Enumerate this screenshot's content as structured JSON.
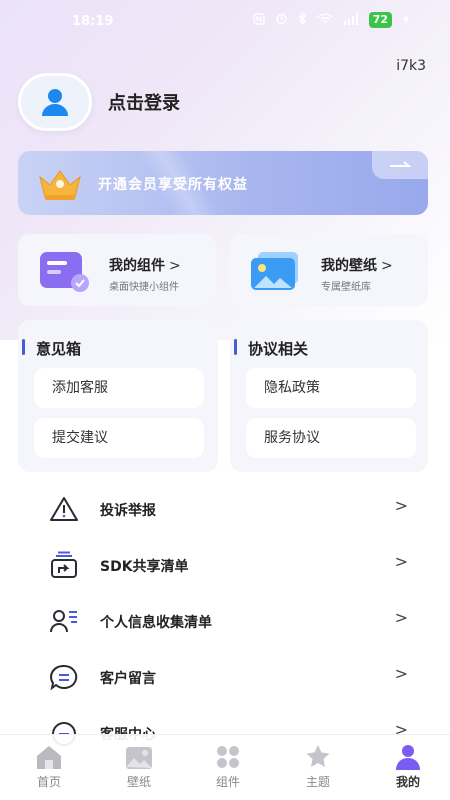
{
  "statusbar": {
    "time": "18:19",
    "battery": "72"
  },
  "top_id": "i7k3",
  "profile": {
    "login_label": "点击登录"
  },
  "vip_banner": {
    "text": "开通会员享受所有权益"
  },
  "features": [
    {
      "title": "我的组件",
      "subtitle": "桌面快捷小组件",
      "chevron": ">"
    },
    {
      "title": "我的壁纸",
      "subtitle": "专属壁纸库",
      "chevron": ">"
    }
  ],
  "feedback": {
    "title": "意见箱",
    "items": [
      "添加客服",
      "提交建议"
    ]
  },
  "agreements": {
    "title": "协议相关",
    "items": [
      "隐私政策",
      "服务协议"
    ]
  },
  "menu": [
    {
      "label": "投诉举报",
      "icon": "warning-icon",
      "chevron": ">"
    },
    {
      "label": "SDK共享清单",
      "icon": "share-list-icon",
      "chevron": ">"
    },
    {
      "label": "个人信息收集清单",
      "icon": "personal-info-icon",
      "chevron": ">"
    },
    {
      "label": "客户留言",
      "icon": "message-icon",
      "chevron": ">"
    },
    {
      "label": "客服中心",
      "icon": "service-center-icon",
      "chevron": ">"
    }
  ],
  "tabs": [
    {
      "label": "首页",
      "icon": "home-icon"
    },
    {
      "label": "壁纸",
      "icon": "wallpaper-icon"
    },
    {
      "label": "组件",
      "icon": "widget-icon"
    },
    {
      "label": "主题",
      "icon": "theme-icon"
    },
    {
      "label": "我的",
      "icon": "profile-icon",
      "active": true
    }
  ],
  "colors": {
    "accent": "#4a5bd6",
    "vip_banner": "#a9b7ef",
    "active_tab": "#7b5cf0"
  }
}
